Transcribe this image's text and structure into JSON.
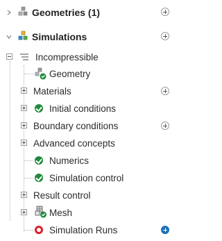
{
  "tree": {
    "geometries": {
      "label": "Geometries (1)",
      "icon": "cubes-gray-icon",
      "expanded": false
    },
    "simulations": {
      "label": "Simulations",
      "icon": "cubes-colored-icon",
      "expanded": true
    },
    "simulation": {
      "label": "Incompressible",
      "icon": "analysis-lines-icon"
    },
    "items": [
      {
        "label": "Geometry",
        "status": "valid"
      },
      {
        "label": "Materials",
        "status": "none"
      },
      {
        "label": "Initial conditions",
        "status": "valid"
      },
      {
        "label": "Boundary conditions",
        "status": "none"
      },
      {
        "label": "Advanced concepts",
        "status": "none"
      },
      {
        "label": "Numerics",
        "status": "valid"
      },
      {
        "label": "Simulation control",
        "status": "valid"
      },
      {
        "label": "Result control",
        "status": "none"
      },
      {
        "label": "Mesh",
        "status": "valid"
      },
      {
        "label": "Simulation Runs",
        "status": "error"
      }
    ]
  },
  "colors": {
    "valid": "#1f8a3b",
    "error": "#d9222a",
    "accent": "#1d6fb8"
  }
}
